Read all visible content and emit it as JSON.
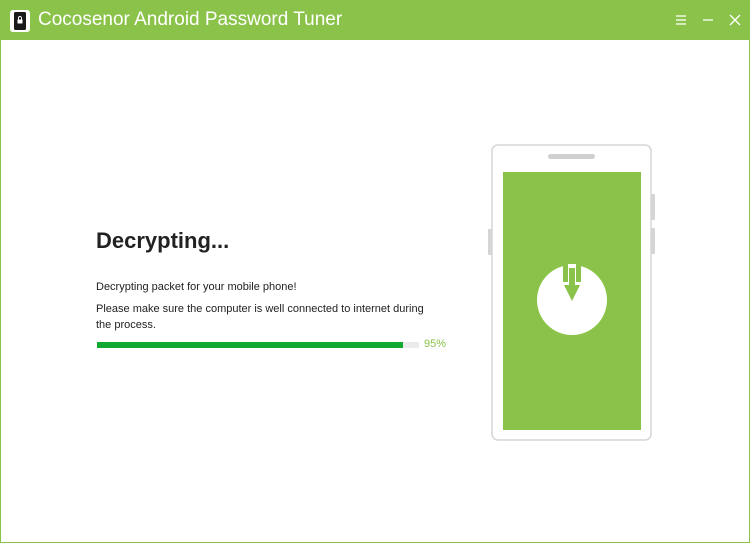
{
  "app": {
    "title": "Cocosenor Android Password Tuner",
    "accent_color": "#8bc34a",
    "progress_color": "#10aa32"
  },
  "title_controls": [
    {
      "name": "menu-icon",
      "icon": "menu-icon"
    },
    {
      "name": "minimize-icon",
      "icon": "minimize-icon"
    },
    {
      "name": "close-icon",
      "icon": "close-icon"
    }
  ],
  "main": {
    "heading": "Decrypting...",
    "message_1": "Decrypting packet for your mobile phone!",
    "message_2": "Please make sure the computer is well connected to internet during the process.",
    "progress": {
      "value": 0.95,
      "label": "95%"
    }
  },
  "illustration": {
    "icon": "phone-download-icon"
  }
}
